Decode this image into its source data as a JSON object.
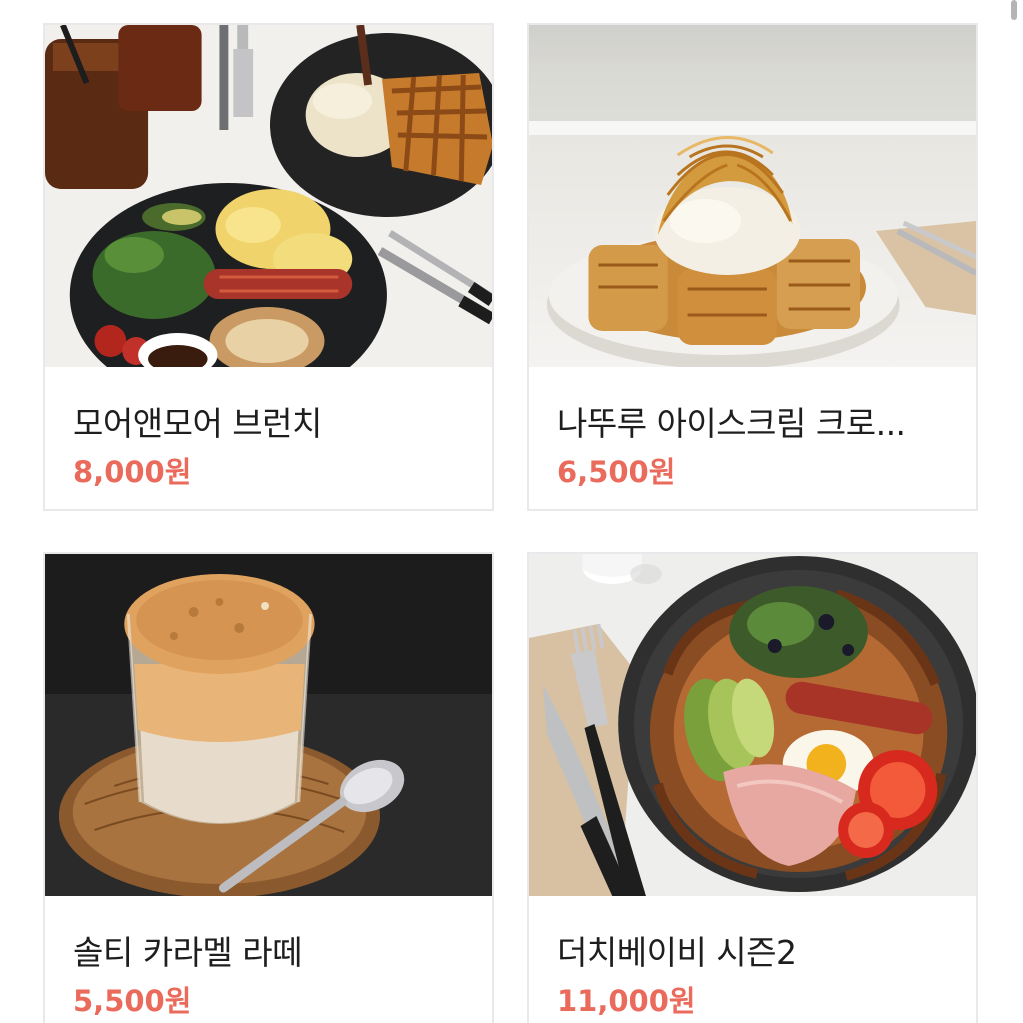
{
  "products": [
    {
      "title": "모어앤모어 브런치",
      "price": "8,000원",
      "image": "brunch-plate-photo"
    },
    {
      "title": "나뚜루 아이스크림 크로...",
      "price": "6,500원",
      "image": "icecream-croffle-photo"
    },
    {
      "title": "솔티 카라멜 라떼",
      "price": "5,500원",
      "image": "salty-caramel-latte-photo"
    },
    {
      "title": "더치베이비 시즌2",
      "price": "11,000원",
      "image": "dutch-baby-photo"
    }
  ],
  "colors": {
    "price": "#ea6a5b",
    "title": "#1e1e1e",
    "card_border": "#e9e9ec"
  }
}
